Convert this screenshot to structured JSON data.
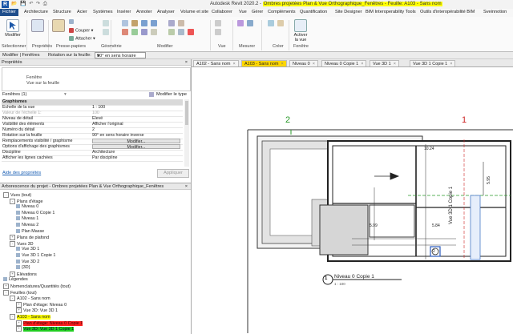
{
  "window": {
    "logo": "R",
    "app_title": "Autodesk Revit 2020.2 - ",
    "doc_title": "Ombres projetées Plan & Vue Orthographique_Fenêtres - Feuille: A103 - Sans nom"
  },
  "menu_tabs": [
    "Fichier",
    "Architecture",
    "Structure",
    "Acier",
    "Systèmes",
    "Insérer",
    "Annoter",
    "Analyser",
    "Volume et site",
    "Collaborer",
    "Vue",
    "Gérer",
    "Compléments",
    "Quantification",
    "Site Designer",
    "BIM Interoperability Tools",
    "Outils d'interopérabilité BIM",
    "Sveinnotion"
  ],
  "ribbon": {
    "modify_label": "Modifier",
    "small_buttons": [
      "Couper",
      "Attacher"
    ],
    "activate_label": "Activer la vue",
    "groups": [
      "Sélectionner",
      "Propriétés",
      "Presse-papiers",
      "Géométrie",
      "Modifier",
      "Vue",
      "Mesurer",
      "Créer",
      "Fenêtre"
    ]
  },
  "options_bar": {
    "context": "Modifier | Fenêtres",
    "rotation_label": "Rotation sur la feuille:",
    "rotation_value": "90° en sens horaire",
    "rotation_arrow": "▾"
  },
  "properties": {
    "title": "Propriétés",
    "type_line1": "Fenêtre",
    "type_line2": "Vue sur la feuille",
    "filter_label": "Fenêtres (1)",
    "edit_type": "Modifier le type",
    "rows": [
      {
        "k": "Graphismes",
        "v": "",
        "kind": "sec"
      },
      {
        "k": "Echelle de la vue",
        "v": "1 : 100",
        "kind": ""
      },
      {
        "k": "Valeur de l'échelle    1:",
        "v": "100",
        "kind": "grey"
      },
      {
        "k": "Niveau de détail",
        "v": "Elevé",
        "kind": ""
      },
      {
        "k": "Visibilité des éléments",
        "v": "Afficher l'original",
        "kind": ""
      },
      {
        "k": "Numéro du détail",
        "v": "2",
        "kind": ""
      },
      {
        "k": "Rotation sur la feuille",
        "v": "90° en sens horaire inverse",
        "kind": ""
      },
      {
        "k": "Remplacements visibilité / graphisme",
        "v": "Modifier...",
        "kind": "btn"
      },
      {
        "k": "Options d'affichage des graphismes",
        "v": "Modifier...",
        "kind": "btn"
      },
      {
        "k": "Discipline",
        "v": "Architecture",
        "kind": ""
      },
      {
        "k": "Afficher les lignes cachées",
        "v": "Par discipline",
        "kind": ""
      }
    ],
    "help_link": "Aide des propriétés",
    "apply": "Appliquer"
  },
  "browser": {
    "title": "Arborescence du projet - Ombres projetées Plan & Vue Orthographique_Fenêtres",
    "items": [
      {
        "t": "Vues (tout)",
        "lvl": 0,
        "exp": "-"
      },
      {
        "t": "Plans d'étage",
        "lvl": 1,
        "exp": "-"
      },
      {
        "t": "Niveau 0",
        "lvl": 2,
        "exp": ""
      },
      {
        "t": "Niveau 0 Copie 1",
        "lvl": 2,
        "exp": ""
      },
      {
        "t": "Niveau 1",
        "lvl": 2,
        "exp": ""
      },
      {
        "t": "Niveau 2",
        "lvl": 2,
        "exp": ""
      },
      {
        "t": "Plan Masse",
        "lvl": 2,
        "exp": ""
      },
      {
        "t": "Plans de plafond",
        "lvl": 1,
        "exp": "+"
      },
      {
        "t": "Vues 3D",
        "lvl": 1,
        "exp": "-"
      },
      {
        "t": "Vue 3D 1",
        "lvl": 2,
        "exp": ""
      },
      {
        "t": "Vue 3D 1 Copie 1",
        "lvl": 2,
        "exp": ""
      },
      {
        "t": "Vue 3D 2",
        "lvl": 2,
        "exp": ""
      },
      {
        "t": "{3D}",
        "lvl": 2,
        "exp": ""
      },
      {
        "t": "Elévations",
        "lvl": 1,
        "exp": "+"
      },
      {
        "t": "Légendes",
        "lvl": 0,
        "exp": ""
      },
      {
        "t": "Nomenclatures/Quantités (tout)",
        "lvl": 0,
        "exp": "+"
      },
      {
        "t": "Feuilles (tout)",
        "lvl": 0,
        "exp": "-"
      },
      {
        "t": "A102 - Sans nom",
        "lvl": 1,
        "exp": "-"
      },
      {
        "t": "Plan d'étage: Niveau 0",
        "lvl": 2,
        "exp": "+"
      },
      {
        "t": "Vue 3D: Vue 3D 1",
        "lvl": 2,
        "exp": "+"
      },
      {
        "t": "A103 - Sans nom",
        "lvl": 1,
        "exp": "-",
        "hl": "yellow"
      },
      {
        "t": "Plan d'étage: Niveau 0 Copie 1",
        "lvl": 2,
        "exp": "+",
        "hl": "red"
      },
      {
        "t": "Vue 3D: Vue 3D 1 Copie 1",
        "lvl": 2,
        "exp": "+",
        "hl": "green"
      }
    ]
  },
  "view_tabs": [
    {
      "label": "A102 - Sans nom",
      "active": false
    },
    {
      "label": "A103 - Sans nom",
      "active": true
    },
    {
      "label": "Niveau 0",
      "active": false
    },
    {
      "label": "Niveau 0 Copie 1",
      "active": false
    },
    {
      "label": "Vue 3D 1",
      "active": false
    },
    {
      "label": "Vue 3D 1 Copie 1",
      "active": false
    }
  ],
  "tab_close": "×",
  "drawing": {
    "grid_left": "2",
    "grid_right": "1",
    "view_title": "Niveau 0 Copie 1",
    "view_scale": "1 : 100",
    "view_number": "1",
    "view3d_title": "Vue 3D 1 Copie 1",
    "view3d_number": "2",
    "dim_1": "5.95",
    "dim_2": "5.84",
    "dim_3": "5.99",
    "dim_4": "10.24"
  },
  "colors": {
    "accent": "#1f4e8c",
    "active_tab": "#ffd700",
    "grid_green": "#2a9a2a",
    "grid_red": "#cc2222"
  }
}
